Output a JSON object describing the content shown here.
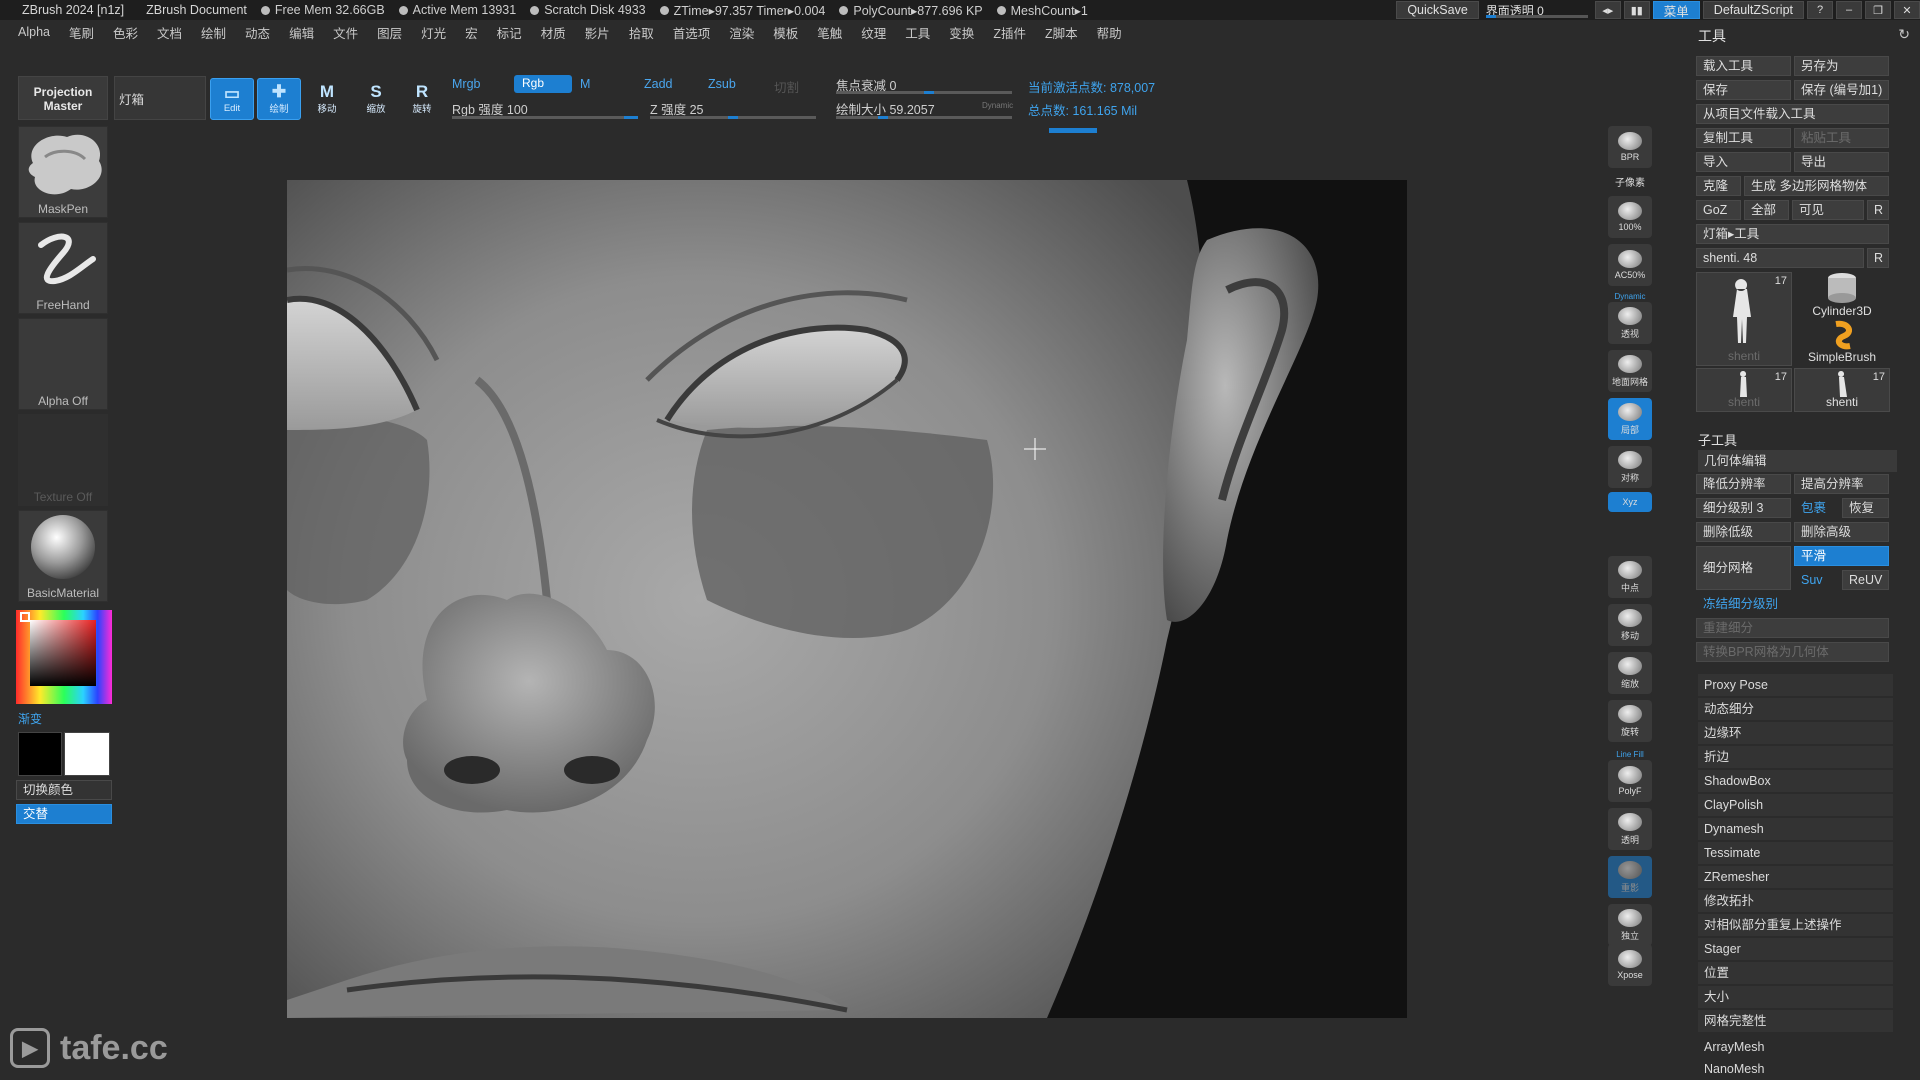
{
  "titlebar": {
    "app": "ZBrush 2024 [n1z]",
    "document": "ZBrush Document",
    "stats": [
      "Free Mem 32.66GB",
      "Active Mem 13931",
      "Scratch Disk 4933",
      "ZTime▸97.357 Timer▸0.004",
      "PolyCount▸877.696 KP",
      "MeshCount▸1"
    ],
    "quicksave": "QuickSave",
    "transparency_label": "界面透明 0",
    "menus_label": "菜单",
    "script": "DefaultZScript"
  },
  "menubar": [
    "Alpha",
    "笔刷",
    "色彩",
    "文档",
    "绘制",
    "动态",
    "编辑",
    "文件",
    "图层",
    "灯光",
    "宏",
    "标记",
    "材质",
    "影片",
    "拾取",
    "首选项",
    "渲染",
    "模板",
    "笔触",
    "纹理",
    "工具",
    "变换",
    "Z插件",
    "Z脚本",
    "帮助"
  ],
  "shelf": {
    "projection_master": "Projection Master",
    "lightbox": "灯箱",
    "tools": [
      {
        "glyph": "▭",
        "label": "Edit",
        "active": true
      },
      {
        "glyph": "✚",
        "label": "绘制",
        "active": true
      },
      {
        "glyph": "M",
        "label": "移动",
        "active": false
      },
      {
        "glyph": "S",
        "label": "缩放",
        "active": false
      },
      {
        "glyph": "R",
        "label": "旋转",
        "active": false
      }
    ],
    "mrgb": "Mrgb",
    "rgb": "Rgb",
    "m": "M",
    "rgb_intensity": "Rgb 强度 100",
    "zadd": "Zadd",
    "zsub": "Zsub",
    "zcut": "切割",
    "z_intensity": "Z 强度 25",
    "focal_shift": "焦点衰减 0",
    "draw_size": "绘制大小 59.2057",
    "dynamic": "Dynamic",
    "active_points": "当前激活点数: 878,007",
    "total_points": "总点数: 161.165 Mil"
  },
  "left": {
    "brush": "MaskPen",
    "stroke": "FreeHand",
    "alpha": "Alpha Off",
    "texture": "Texture Off",
    "material": "BasicMaterial",
    "gradient": "渐变",
    "switch_color": "切换颜色",
    "alternate": "交替"
  },
  "rightstrip": [
    {
      "label": "BPR",
      "top": "bpr"
    },
    {
      "label": "子像素"
    },
    {
      "label": "100%"
    },
    {
      "label": "AC50%"
    },
    {
      "label": "Dynamic"
    },
    {
      "label": "透视"
    },
    {
      "label": "地面网格"
    },
    {
      "label": "局部"
    },
    {
      "label": "对称"
    },
    {
      "label": "Xyz"
    },
    {
      "label": "中点"
    },
    {
      "label": "移动"
    },
    {
      "label": "缩放"
    },
    {
      "label": "旋转"
    },
    {
      "label": "Line Fill"
    },
    {
      "label": "PolyF"
    },
    {
      "label": "透明"
    },
    {
      "label": "重影"
    },
    {
      "label": "独立"
    },
    {
      "label": "Xpose"
    }
  ],
  "panel": {
    "title": "工具",
    "load_tool": "载入工具",
    "save_as": "另存为",
    "save": "保存",
    "save_inc": "保存 (编号加1)",
    "load_from_project": "从项目文件载入工具",
    "copy_tool": "复制工具",
    "paste_tool": "粘贴工具",
    "import": "导入",
    "export": "导出",
    "clone": "克隆",
    "make_polymesh": "生成 多边形网格物体",
    "goz": "GoZ",
    "all": "全部",
    "visible": "可见",
    "r": "R",
    "lightbox_tools": "灯箱▸工具",
    "current_tool": "shenti. 48",
    "subtools_thumbs": [
      {
        "name": "shenti",
        "count": "17",
        "dim": true
      },
      {
        "name": "Cylinder3D",
        "count": "",
        "dim": false
      },
      {
        "name": "SimpleBrush",
        "count": "",
        "dim": false
      },
      {
        "name": "shenti",
        "count": "17",
        "dim": true
      },
      {
        "name": "shenti",
        "count": "17",
        "dim": false
      }
    ],
    "subtool_header": "子工具",
    "geometry_header": "几何体编辑",
    "lower_res": "降低分辨率",
    "higher_res": "提高分辨率",
    "sdiv": "细分级别 3",
    "cage": "包裹",
    "restore": "恢复",
    "del_lower": "删除低级",
    "del_higher": "删除高级",
    "divide": "细分网格",
    "smooth": "平滑",
    "suv": "Suv",
    "reuv": "ReUV",
    "freeze_sdiv": "冻结细分级别",
    "reconstruct": "重建细分",
    "convert_bpr": "转换BPR网格为几何体",
    "items": [
      "Proxy Pose",
      "动态细分",
      "边缘环",
      "折边",
      "ShadowBox",
      "ClayPolish",
      "Dynamesh",
      "Tessimate",
      "ZRemesher",
      "修改拓扑",
      "对相似部分重复上述操作",
      "Stager",
      "位置",
      "大小",
      "网格完整性"
    ],
    "bottom_items": [
      "ArrayMesh",
      "NanoMesh"
    ]
  },
  "watermark": "tafe.cc",
  "colors": {
    "accent": "#1d7fd1",
    "stat_blue": "#3fa4ee",
    "bg": "#2b2b2b"
  }
}
